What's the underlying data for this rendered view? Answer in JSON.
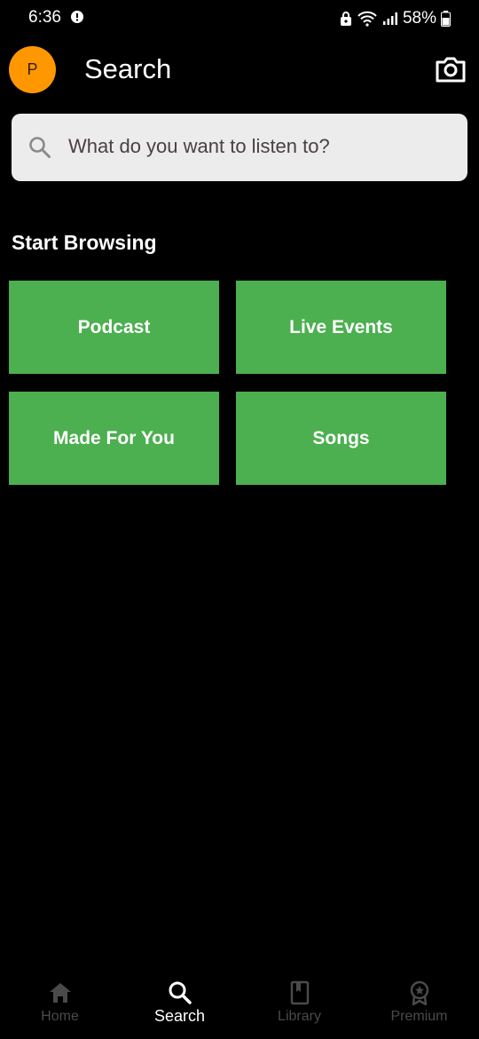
{
  "status_bar": {
    "time": "6:36",
    "battery_percent": "58%",
    "icons": [
      "alert-icon",
      "lock-icon",
      "wifi-icon",
      "signal-icon",
      "battery-icon"
    ]
  },
  "header": {
    "avatar_initial": "P",
    "title": "Search",
    "camera_icon": "camera-icon"
  },
  "search": {
    "placeholder": "What do you want to listen to?",
    "icon": "search-icon"
  },
  "browse": {
    "heading": "Start Browsing",
    "categories": [
      {
        "label": "Podcast"
      },
      {
        "label": "Live Events"
      },
      {
        "label": "Made For You"
      },
      {
        "label": "Songs"
      }
    ]
  },
  "bottom_nav": {
    "items": [
      {
        "label": "Home",
        "icon": "home-icon",
        "active": false
      },
      {
        "label": "Search",
        "icon": "search-icon",
        "active": true
      },
      {
        "label": "Library",
        "icon": "library-icon",
        "active": false
      },
      {
        "label": "Premium",
        "icon": "premium-icon",
        "active": false
      }
    ]
  },
  "colors": {
    "background": "#000000",
    "tile": "#4caf50",
    "avatar": "#ff9800",
    "search_bg": "#ececec",
    "nav_inactive": "#4a4a4a",
    "nav_active": "#ffffff"
  }
}
